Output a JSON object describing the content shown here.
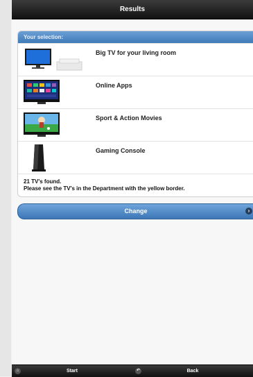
{
  "header": {
    "title": "Results"
  },
  "panel": {
    "title": "Your selection:",
    "items": [
      {
        "label": "Big TV for your living room",
        "icon": "big-tv-image"
      },
      {
        "label": "Online Apps",
        "icon": "online-apps-tv-image"
      },
      {
        "label": "Sport & Action Movies",
        "icon": "sport-tv-image"
      },
      {
        "label": "Gaming Console",
        "icon": "gaming-console-image"
      }
    ],
    "summary_line1": "21 TV's found.",
    "summary_line2": "Please see the TV's in the Department with the yellow border."
  },
  "change_button": {
    "label": "Change",
    "icon": "chevron-right-icon"
  },
  "footer": {
    "start": {
      "label": "Start",
      "icon": "home-icon"
    },
    "back": {
      "label": "Back",
      "icon": "back-icon"
    }
  },
  "colors": {
    "header_bg": "#1e1e1e",
    "accent_blue": "#4a84c4",
    "panel_bg": "#ffffff",
    "footer_bg": "#1a1a1a"
  }
}
